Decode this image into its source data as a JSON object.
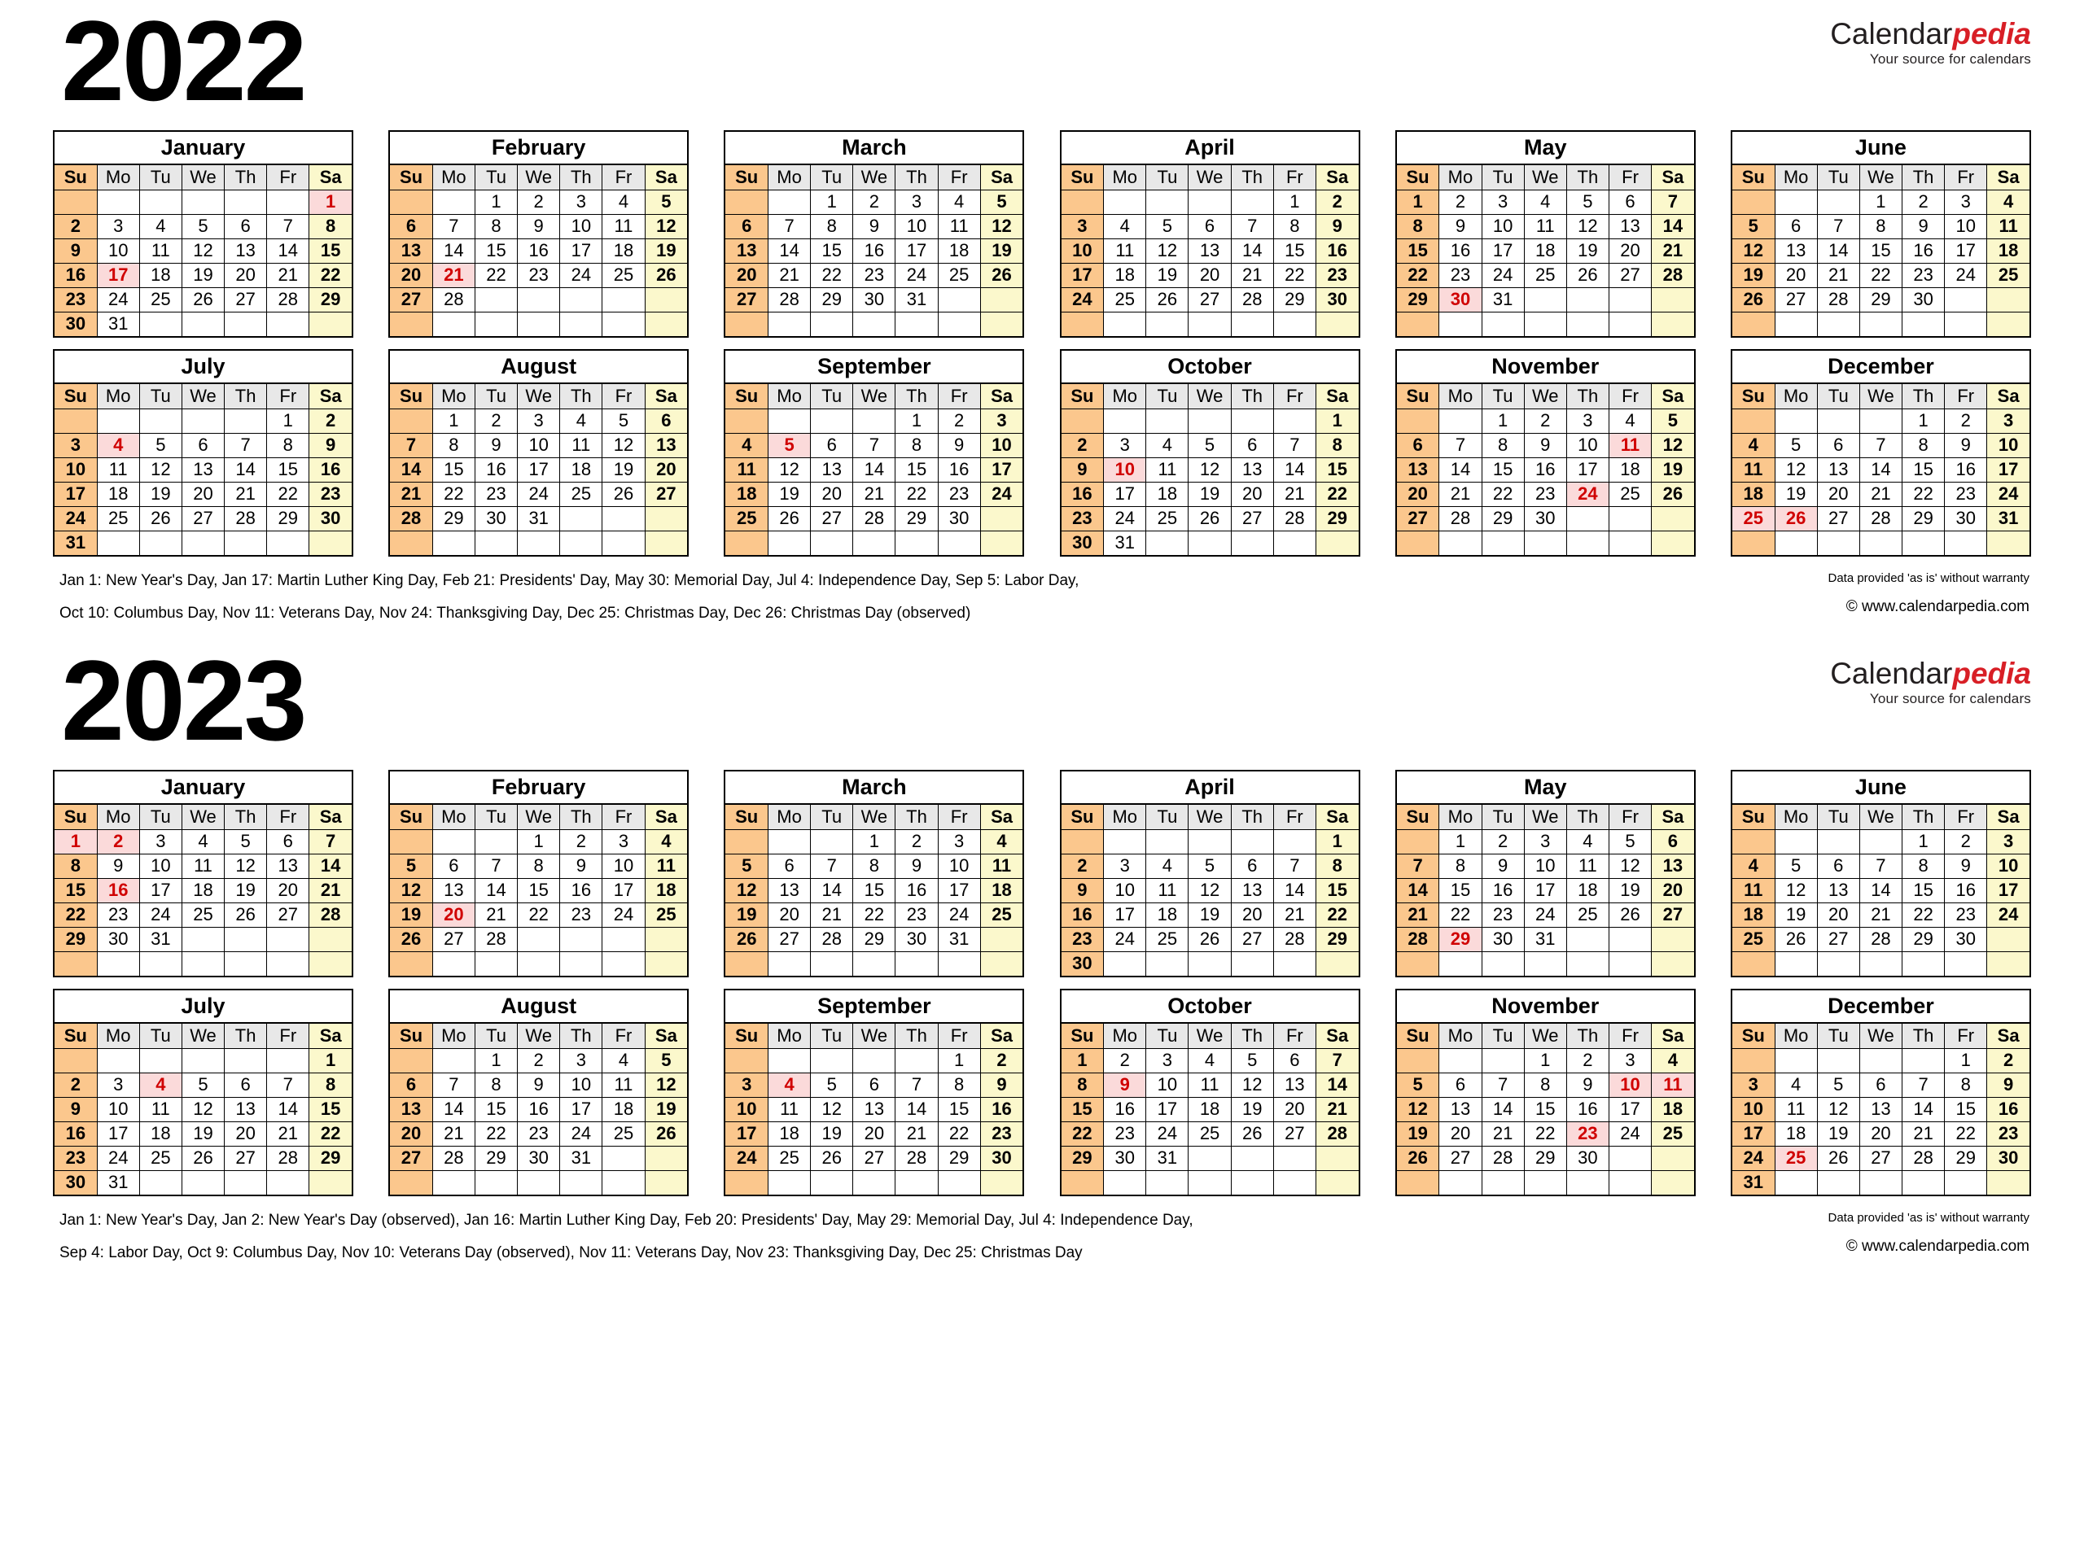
{
  "brand": {
    "name_part1": "Calendar",
    "name_part2": "pedia",
    "tagline": "Your source for calendars"
  },
  "colors": {
    "sunday_bg": "#fbc78d",
    "saturday_bg": "#fbf8cc",
    "weekday_header_bg": "#e8e8e8",
    "holiday_bg": "#fbdada",
    "holiday_text": "#d00000",
    "brand_red": "#d81f26",
    "border": "#000000"
  },
  "weekday_headers": [
    "Su",
    "Mo",
    "Tu",
    "We",
    "Th",
    "Fr",
    "Sa"
  ],
  "years": [
    {
      "year": "2022",
      "footer_left_line1": "Jan 1: New Year's Day, Jan 17: Martin Luther King Day, Feb 21: Presidents' Day, May 30: Memorial Day, Jul 4: Independence Day, Sep 5: Labor Day,",
      "footer_left_line2": "Oct 10: Columbus Day, Nov 11: Veterans Day, Nov 24: Thanksgiving Day, Dec 25: Christmas Day, Dec 26: Christmas Day (observed)",
      "footer_right_line1": "Data provided 'as is' without warranty",
      "footer_right_line2": "© www.calendarpedia.com",
      "months": [
        {
          "name": "January",
          "first_weekday": 6,
          "days": 31,
          "holidays": [
            1,
            17
          ]
        },
        {
          "name": "February",
          "first_weekday": 2,
          "days": 28,
          "holidays": [
            21
          ]
        },
        {
          "name": "March",
          "first_weekday": 2,
          "days": 31,
          "holidays": []
        },
        {
          "name": "April",
          "first_weekday": 5,
          "days": 30,
          "holidays": []
        },
        {
          "name": "May",
          "first_weekday": 0,
          "days": 31,
          "holidays": [
            30
          ]
        },
        {
          "name": "June",
          "first_weekday": 3,
          "days": 30,
          "holidays": []
        },
        {
          "name": "July",
          "first_weekday": 5,
          "days": 31,
          "holidays": [
            4
          ]
        },
        {
          "name": "August",
          "first_weekday": 1,
          "days": 31,
          "holidays": []
        },
        {
          "name": "September",
          "first_weekday": 4,
          "days": 30,
          "holidays": [
            5
          ]
        },
        {
          "name": "October",
          "first_weekday": 6,
          "days": 31,
          "holidays": [
            10
          ]
        },
        {
          "name": "November",
          "first_weekday": 2,
          "days": 30,
          "holidays": [
            11,
            24
          ]
        },
        {
          "name": "December",
          "first_weekday": 4,
          "days": 31,
          "holidays": [
            25,
            26
          ]
        }
      ]
    },
    {
      "year": "2023",
      "footer_left_line1": "Jan 1: New Year's Day, Jan 2: New Year's Day (observed), Jan 16: Martin Luther King Day, Feb 20: Presidents' Day, May 29: Memorial Day, Jul 4: Independence Day,",
      "footer_left_line2": "Sep 4: Labor Day, Oct 9: Columbus Day, Nov 10: Veterans Day (observed), Nov 11: Veterans Day, Nov 23: Thanksgiving Day, Dec 25: Christmas Day",
      "footer_right_line1": "Data provided 'as is' without warranty",
      "footer_right_line2": "© www.calendarpedia.com",
      "months": [
        {
          "name": "January",
          "first_weekday": 0,
          "days": 31,
          "holidays": [
            1,
            2,
            16
          ]
        },
        {
          "name": "February",
          "first_weekday": 3,
          "days": 28,
          "holidays": [
            20
          ]
        },
        {
          "name": "March",
          "first_weekday": 3,
          "days": 31,
          "holidays": []
        },
        {
          "name": "April",
          "first_weekday": 6,
          "days": 30,
          "holidays": []
        },
        {
          "name": "May",
          "first_weekday": 1,
          "days": 31,
          "holidays": [
            29
          ]
        },
        {
          "name": "June",
          "first_weekday": 4,
          "days": 30,
          "holidays": []
        },
        {
          "name": "July",
          "first_weekday": 6,
          "days": 31,
          "holidays": [
            4
          ]
        },
        {
          "name": "August",
          "first_weekday": 2,
          "days": 31,
          "holidays": []
        },
        {
          "name": "September",
          "first_weekday": 5,
          "days": 30,
          "holidays": [
            4
          ]
        },
        {
          "name": "October",
          "first_weekday": 0,
          "days": 31,
          "holidays": [
            9
          ]
        },
        {
          "name": "November",
          "first_weekday": 3,
          "days": 30,
          "holidays": [
            10,
            11,
            23
          ]
        },
        {
          "name": "December",
          "first_weekday": 5,
          "days": 31,
          "holidays": [
            25
          ]
        }
      ]
    }
  ]
}
